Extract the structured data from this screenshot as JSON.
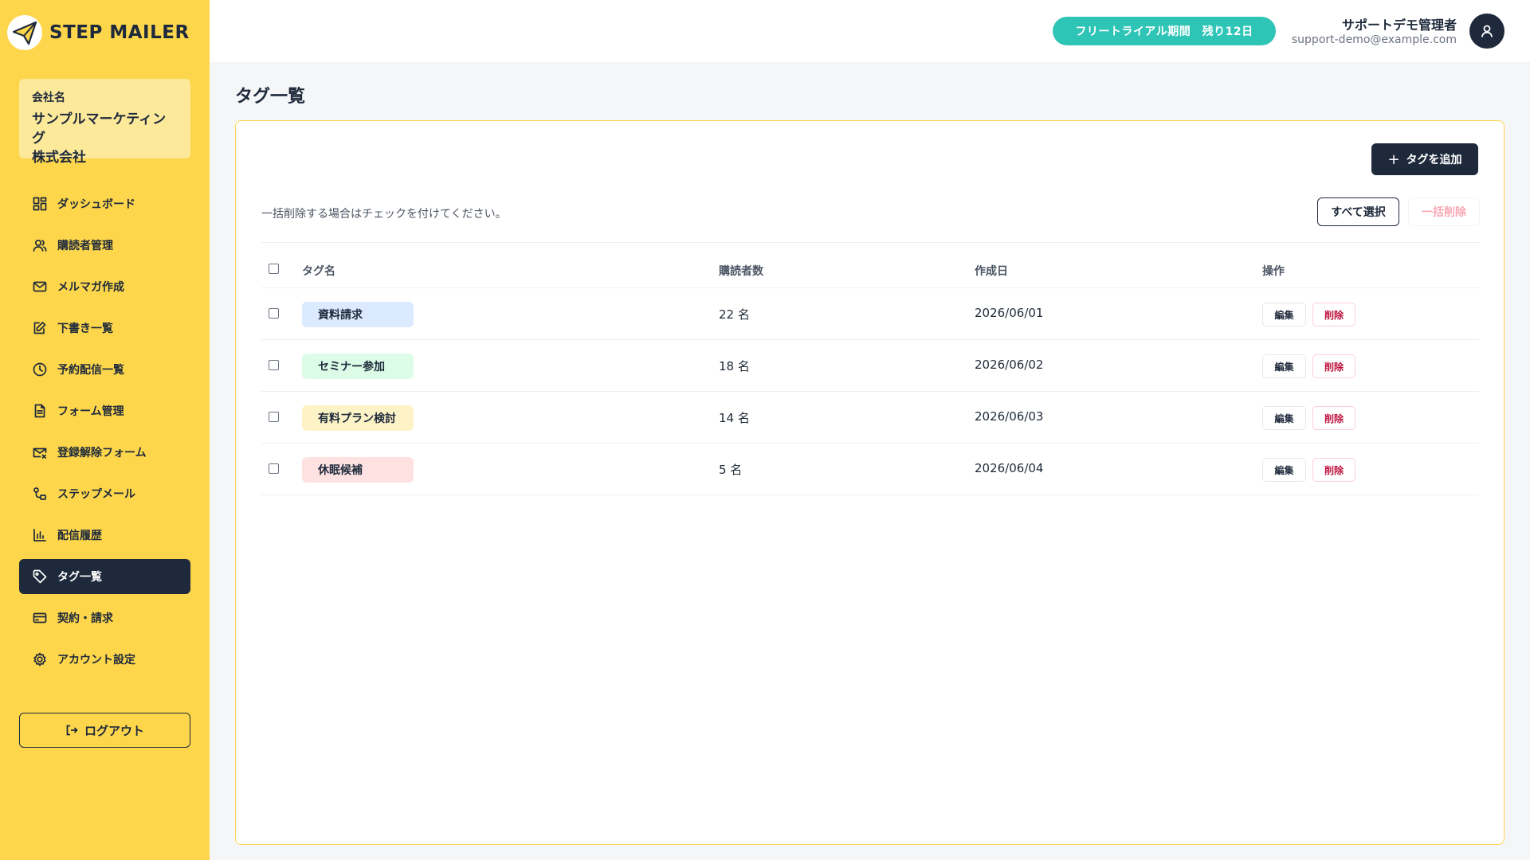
{
  "brand": {
    "name": "STEP MAILER"
  },
  "company": {
    "label": "会社名",
    "name_line1": "サンプルマーケティング",
    "name_line2": "株式会社"
  },
  "sidebar": {
    "items": [
      {
        "label": "ダッシュボード",
        "icon": "dashboard-icon"
      },
      {
        "label": "購読者管理",
        "icon": "users-icon"
      },
      {
        "label": "メルマガ作成",
        "icon": "mail-icon"
      },
      {
        "label": "下書き一覧",
        "icon": "edit-icon"
      },
      {
        "label": "予約配信一覧",
        "icon": "clock-icon"
      },
      {
        "label": "フォーム管理",
        "icon": "form-icon"
      },
      {
        "label": "登録解除フォーム",
        "icon": "mail-x-icon"
      },
      {
        "label": "ステップメール",
        "icon": "step-icon"
      },
      {
        "label": "配信履歴",
        "icon": "chart-icon"
      },
      {
        "label": "タグ一覧",
        "icon": "tag-icon",
        "active": true
      },
      {
        "label": "契約・請求",
        "icon": "card-icon"
      },
      {
        "label": "アカウント設定",
        "icon": "gear-icon"
      }
    ],
    "logout_label": "ログアウト"
  },
  "header": {
    "trial_badge": "フリートライアル期間　残り12日",
    "user_name": "サポートデモ管理者",
    "user_email": "support-demo@example.com"
  },
  "main": {
    "page_title": "タグ一覧",
    "add_button": "タグを追加",
    "hint": "一括削除する場合はチェックを付けてください。",
    "select_all": "すべて選択",
    "bulk_delete": "一括削除",
    "columns": {
      "name": "タグ名",
      "count": "購読者数",
      "date": "作成日",
      "ops": "操作"
    },
    "edit_label": "編集",
    "delete_label": "削除",
    "rows": [
      {
        "tag": "資料請求",
        "count": "22 名",
        "date": "2026/06/01",
        "color": "#dbeafe"
      },
      {
        "tag": "セミナー参加",
        "count": "18 名",
        "date": "2026/06/02",
        "color": "#dcfce7"
      },
      {
        "tag": "有料プラン検討",
        "count": "14 名",
        "date": "2026/06/03",
        "color": "#fef3c7"
      },
      {
        "tag": "休眠候補",
        "count": "5 名",
        "date": "2026/06/04",
        "color": "#fee2e2"
      }
    ]
  },
  "colors": {
    "sidebar_bg": "#fdd64b",
    "navy": "#1e293b",
    "teal": "#2ec4b6",
    "card_border": "#fcd34d"
  }
}
